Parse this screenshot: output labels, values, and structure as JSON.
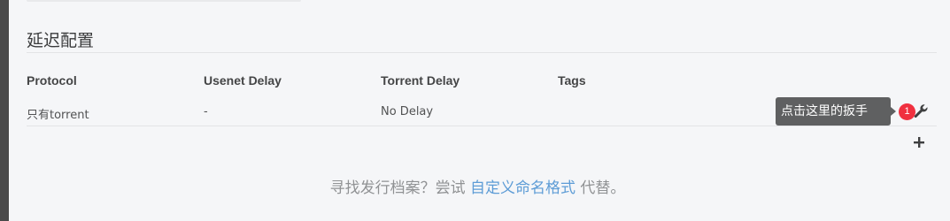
{
  "section": {
    "title": "延迟配置"
  },
  "table": {
    "columns": [
      "Protocol",
      "Usenet Delay",
      "Torrent Delay",
      "Tags"
    ],
    "rows": [
      {
        "protocol": "只有torrent",
        "usenet_delay": "-",
        "torrent_delay": "No Delay",
        "tags": ""
      }
    ]
  },
  "tooltip": {
    "text": "点击这里的扳手",
    "badge": "1"
  },
  "icons": {
    "edit": "wrench-icon",
    "add": "plus-icon"
  },
  "footer": {
    "before": "寻找发行档案？尝试 ",
    "link": "自定义命名格式",
    "after": " 代替。"
  },
  "colors": {
    "badge": "#f0303f",
    "tooltip_bg": "#5f6061",
    "link": "#5d9cd6",
    "background": "#f5f6f8"
  }
}
